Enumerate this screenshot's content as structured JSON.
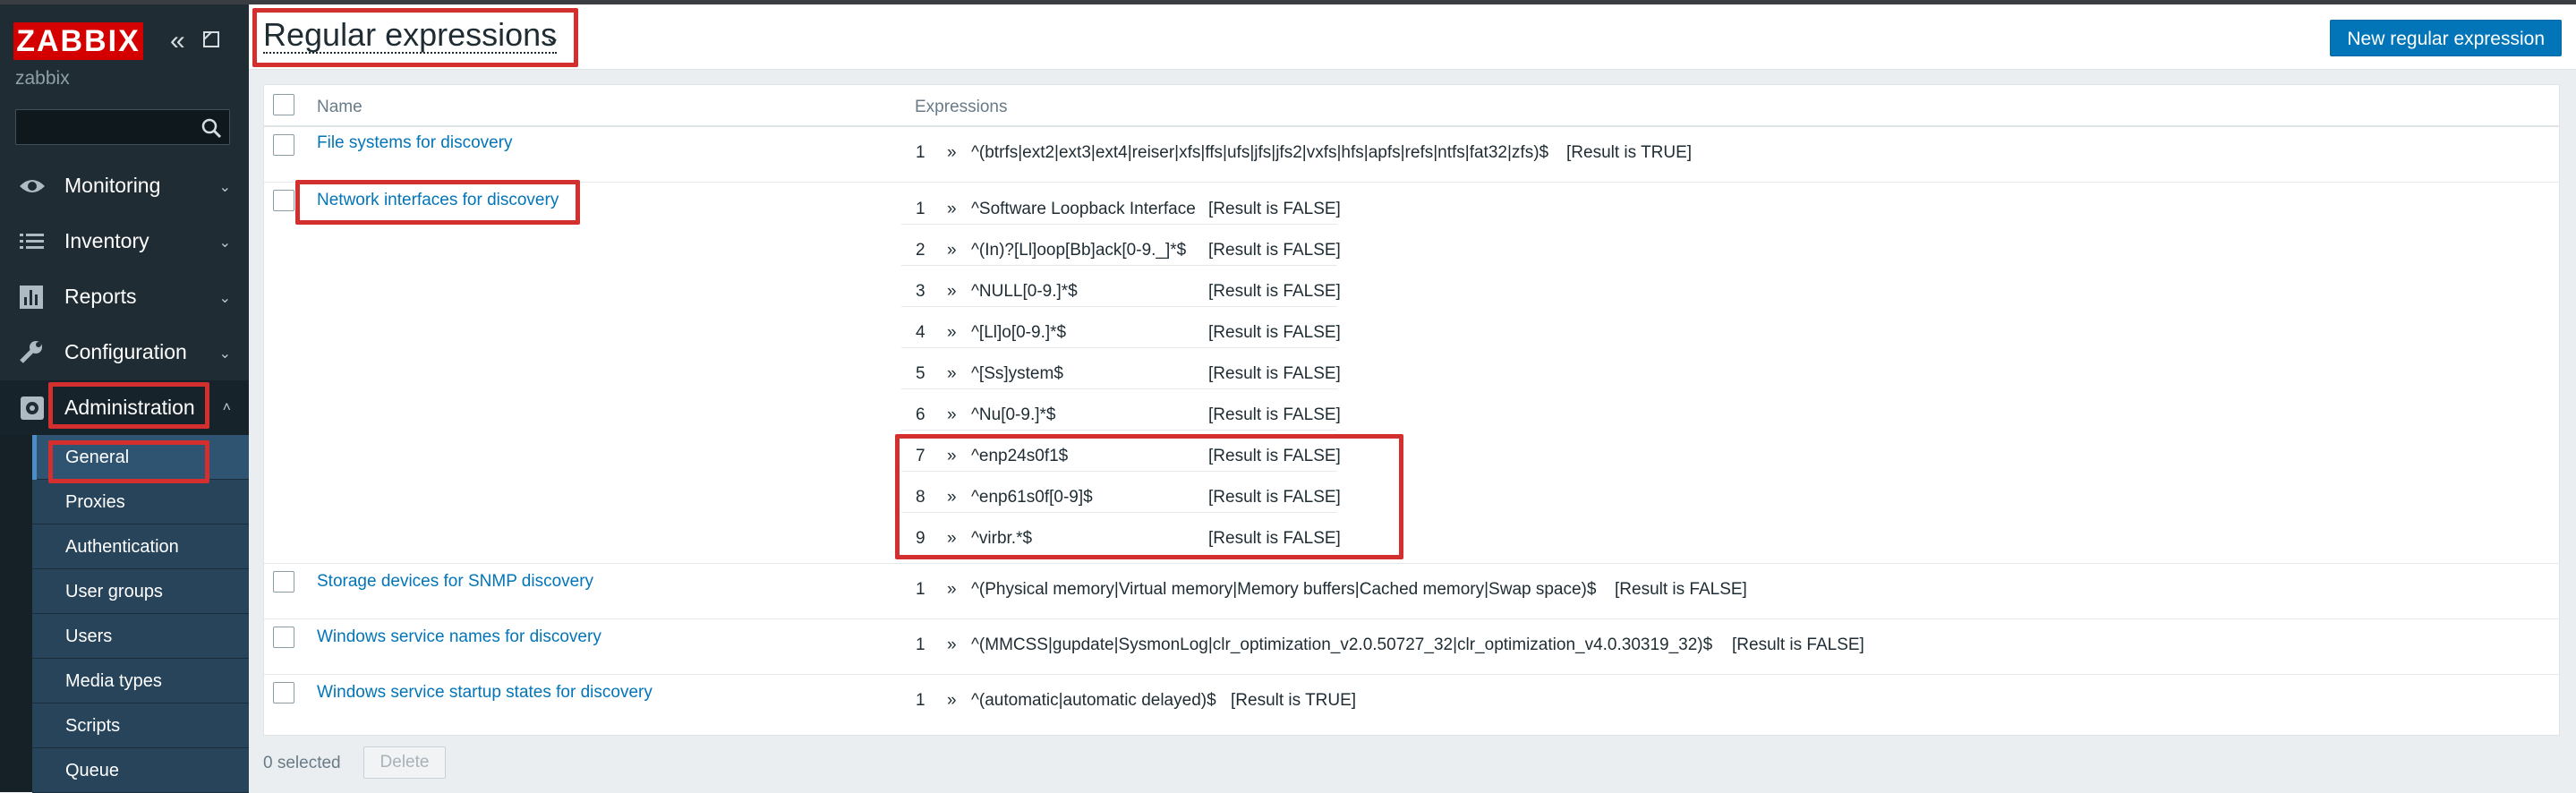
{
  "app": {
    "logo_text": "ZABBIX",
    "server_name": "zabbix"
  },
  "search": {
    "placeholder": ""
  },
  "nav": [
    {
      "label": "Monitoring",
      "icon": "eye-icon"
    },
    {
      "label": "Inventory",
      "icon": "list-icon"
    },
    {
      "label": "Reports",
      "icon": "bar-chart-icon"
    },
    {
      "label": "Configuration",
      "icon": "wrench-icon"
    },
    {
      "label": "Administration",
      "icon": "gear-icon"
    }
  ],
  "submenu": [
    {
      "label": "General"
    },
    {
      "label": "Proxies"
    },
    {
      "label": "Authentication"
    },
    {
      "label": "User groups"
    },
    {
      "label": "Users"
    },
    {
      "label": "Media types"
    },
    {
      "label": "Scripts"
    },
    {
      "label": "Queue"
    }
  ],
  "header": {
    "title": "Regular expressions",
    "new_button": "New regular expression"
  },
  "table": {
    "columns": [
      "Name",
      "Expressions"
    ],
    "rows": [
      {
        "name": "File systems for discovery",
        "expressions": [
          {
            "n": "1",
            "text": "^(btrfs|ext2|ext3|ext4|reiser|xfs|ffs|ufs|jfs|jfs2|vxfs|hfs|apfs|refs|ntfs|fat32|zfs)$",
            "result": "[Result is TRUE]"
          }
        ]
      },
      {
        "name": "Network interfaces for discovery",
        "expressions": [
          {
            "n": "1",
            "text": "^Software Loopback Interface",
            "result": "[Result is FALSE]"
          },
          {
            "n": "2",
            "text": "^(In)?[Ll]oop[Bb]ack[0-9._]*$",
            "result": "[Result is FALSE]"
          },
          {
            "n": "3",
            "text": "^NULL[0-9.]*$",
            "result": "[Result is FALSE]"
          },
          {
            "n": "4",
            "text": "^[Ll]o[0-9.]*$",
            "result": "[Result is FALSE]"
          },
          {
            "n": "5",
            "text": "^[Ss]ystem$",
            "result": "[Result is FALSE]"
          },
          {
            "n": "6",
            "text": "^Nu[0-9.]*$",
            "result": "[Result is FALSE]"
          },
          {
            "n": "7",
            "text": "^enp24s0f1$",
            "result": "[Result is FALSE]"
          },
          {
            "n": "8",
            "text": "^enp61s0f[0-9]$",
            "result": "[Result is FALSE]"
          },
          {
            "n": "9",
            "text": "^virbr.*$",
            "result": "[Result is FALSE]"
          }
        ]
      },
      {
        "name": "Storage devices for SNMP discovery",
        "expressions": [
          {
            "n": "1",
            "text": "^(Physical memory|Virtual memory|Memory buffers|Cached memory|Swap space)$",
            "result": "[Result is FALSE]"
          }
        ]
      },
      {
        "name": "Windows service names for discovery",
        "expressions": [
          {
            "n": "1",
            "text": "^(MMCSS|gupdate|SysmonLog|clr_optimization_v2.0.50727_32|clr_optimization_v4.0.30319_32)$",
            "result": "[Result is FALSE]"
          }
        ]
      },
      {
        "name": "Windows service startup states for discovery",
        "expressions": [
          {
            "n": "1",
            "text": "^(automatic|automatic delayed)$",
            "result": "[Result is TRUE]"
          }
        ]
      }
    ],
    "arrow": "»"
  },
  "footer": {
    "selected": "0 selected",
    "delete_label": "Delete"
  },
  "colors": {
    "accent": "#0275b8",
    "sidebar": "#1f2c33",
    "highlight": "#d32f2f"
  }
}
